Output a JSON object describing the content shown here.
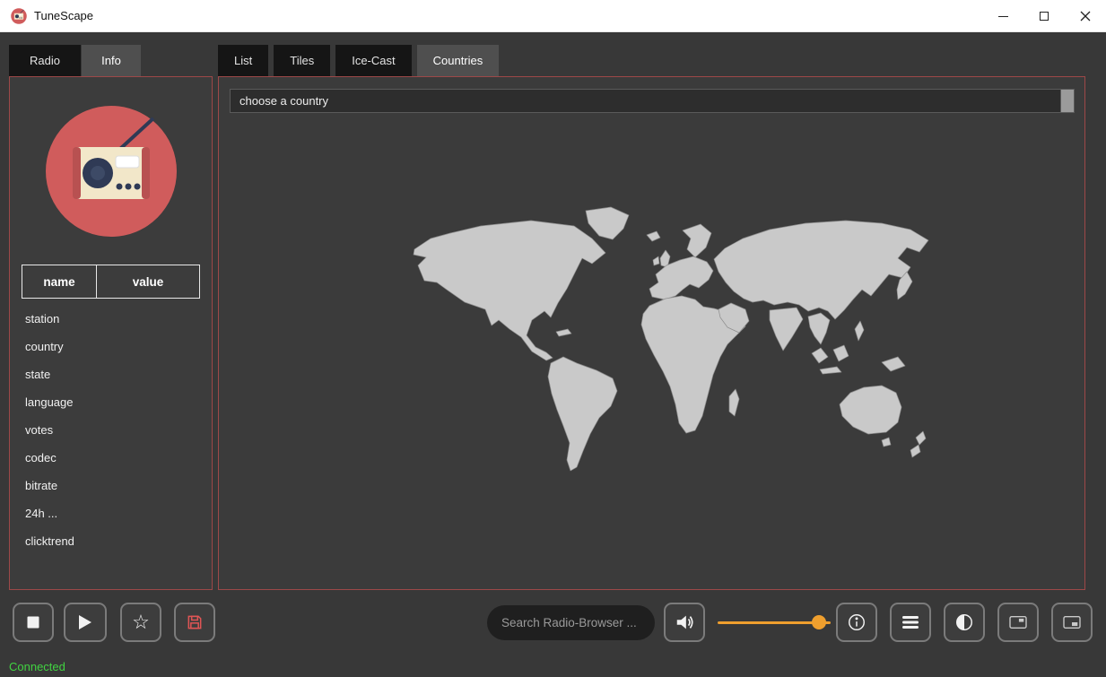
{
  "window": {
    "title": "TuneScape"
  },
  "left_panel": {
    "tabs": [
      {
        "label": "Radio",
        "active": false
      },
      {
        "label": "Info",
        "active": true
      }
    ],
    "table": {
      "headers": [
        "name",
        "value"
      ],
      "rows": [
        "station",
        "country",
        "state",
        "language",
        "votes",
        "codec",
        "bitrate",
        "24h ...",
        "clicktrend"
      ]
    }
  },
  "right_panel": {
    "tabs": [
      {
        "label": "List",
        "active": false
      },
      {
        "label": "Tiles",
        "active": false
      },
      {
        "label": "Ice-Cast",
        "active": false
      },
      {
        "label": "Countries",
        "active": true
      }
    ],
    "country_selector": {
      "value": "choose a country"
    }
  },
  "toolbar": {
    "search_placeholder": "Search Radio-Browser ...",
    "volume_percent": 90
  },
  "status_bar": {
    "connection": "Connected"
  },
  "icons": {
    "star": "☆"
  },
  "colors": {
    "panel_border": "#9d4848",
    "volume_accent": "#ef9f2e",
    "status_connected": "#41d341",
    "logo_red": "#d05c5c",
    "map_land": "#c9c9c9"
  }
}
